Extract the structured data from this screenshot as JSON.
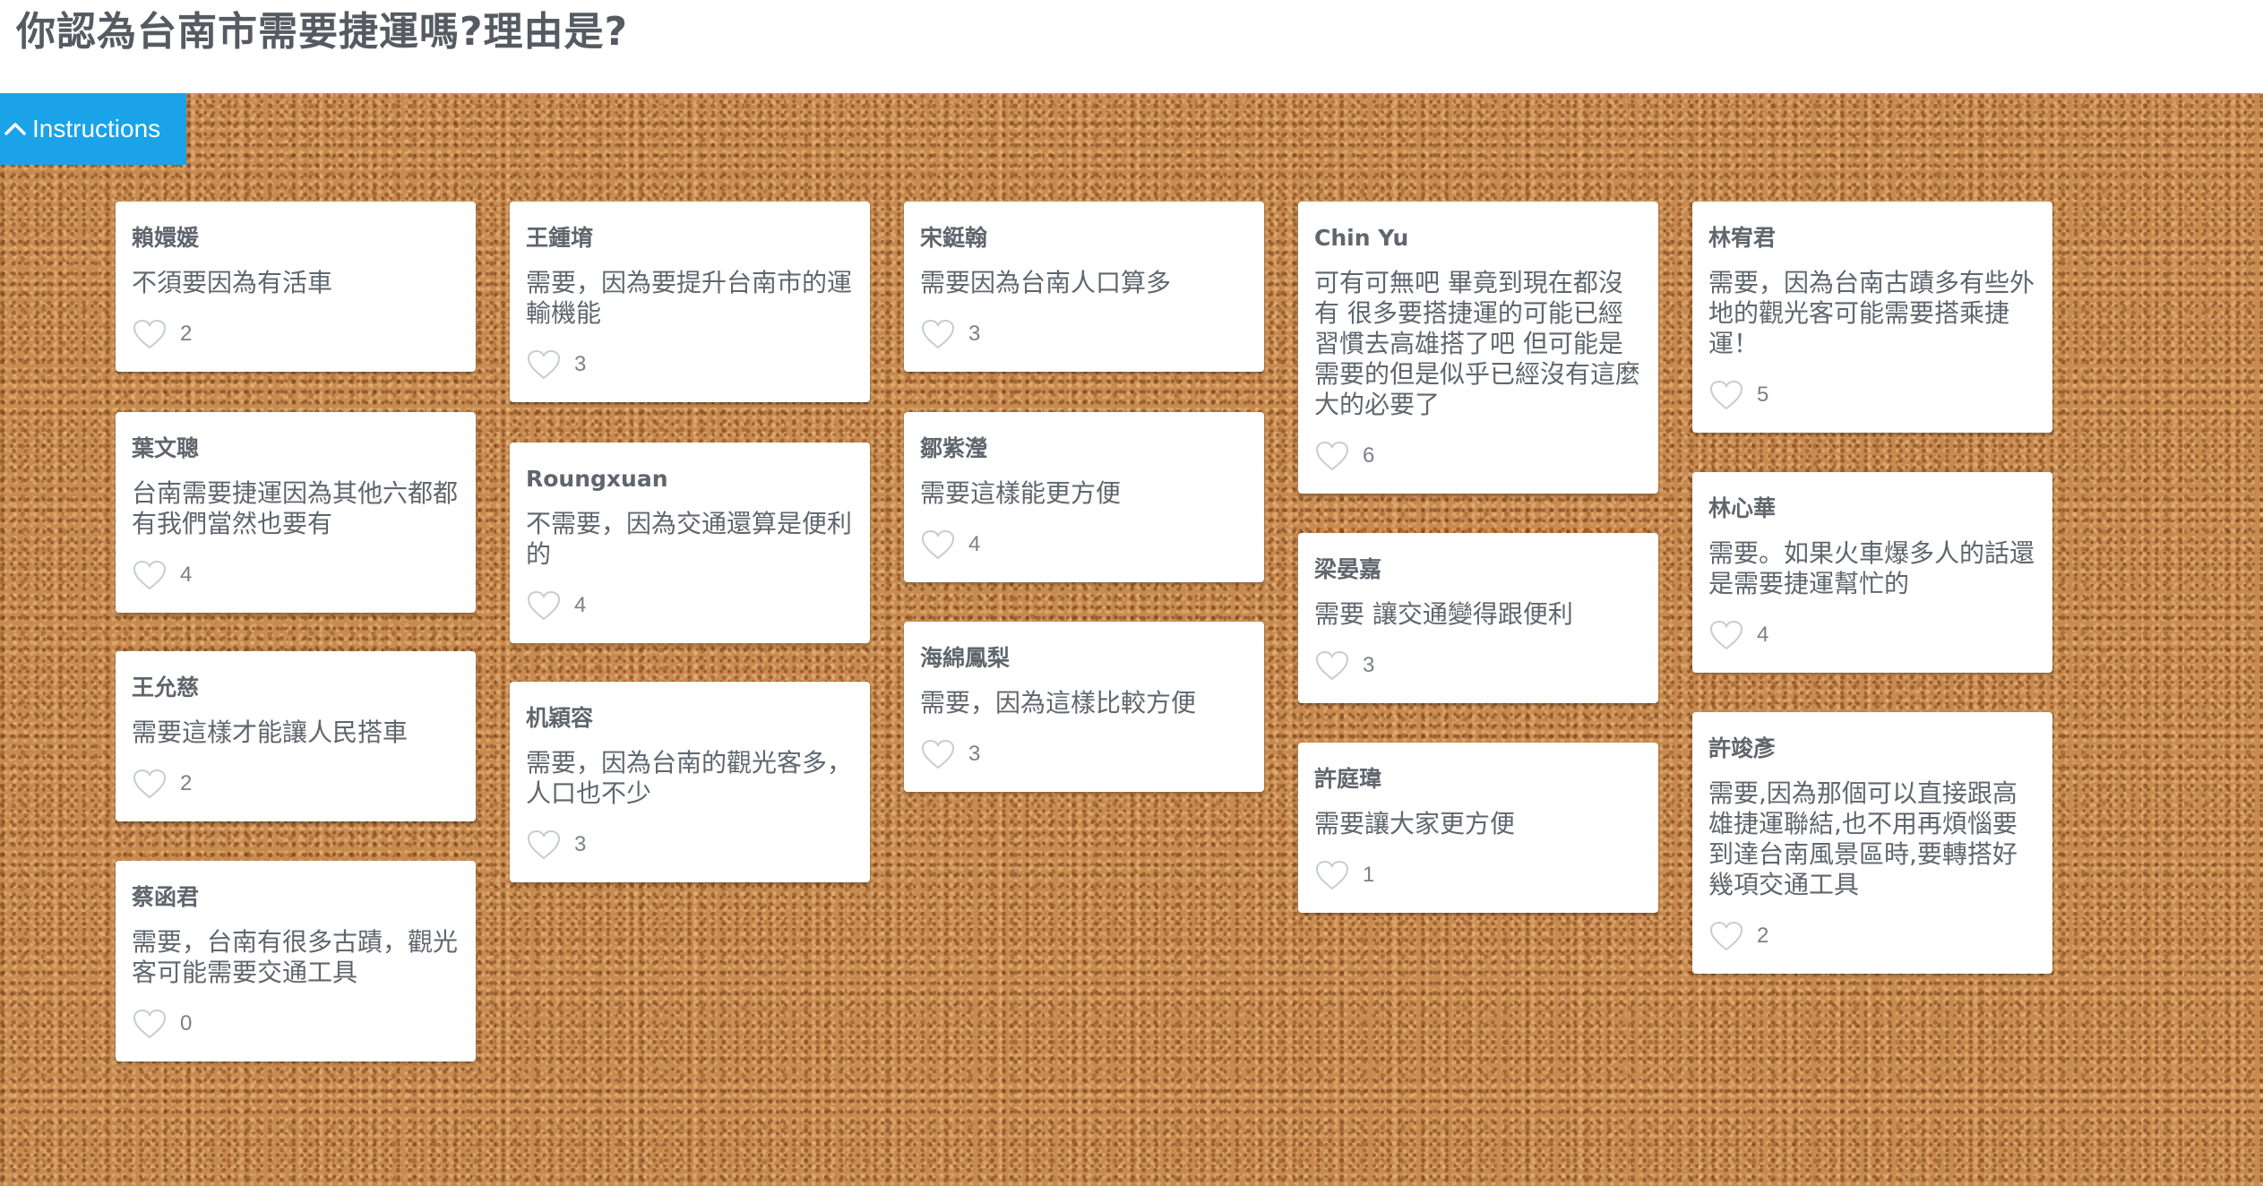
{
  "title": "你認為台南市需要捷運嗎?理由是?",
  "instructions_label": "Instructions",
  "icons": {
    "instructions_toggle": "chevron-up-icon",
    "like": "heart-outline-icon"
  },
  "colors": {
    "accent": "#1aa3e8",
    "board": "#c98a4e",
    "text": "#5f666d"
  },
  "cards": [
    {
      "author": "賴嬛媛",
      "text": "不須要因為有活車",
      "likes": "2"
    },
    {
      "author": "葉文聰",
      "text": "台南需要捷運因為其他六都都有我們當然也要有",
      "likes": "4"
    },
    {
      "author": "王允慈",
      "text": "需要這樣才能讓人民搭車",
      "likes": "2"
    },
    {
      "author": "蔡函君",
      "text": "需要，台南有很多古蹟，觀光客可能需要交通工具",
      "likes": "0"
    },
    {
      "author": "王鍾堉",
      "text": "需要，因為要提升台南市的運輸機能",
      "likes": "3"
    },
    {
      "author": "Roungxuan",
      "text": "不需要，因為交通還算是便利的",
      "likes": "4"
    },
    {
      "author": "机穎容",
      "text": "需要，因為台南的觀光客多，人口也不少",
      "likes": "3"
    },
    {
      "author": "宋鋌翰",
      "text": "需要因為台南人口算多",
      "likes": "3"
    },
    {
      "author": "鄒紫瀅",
      "text": "需要這樣能更方便",
      "likes": "4"
    },
    {
      "author": "海綿鳳梨",
      "text": "需要，因為這樣比較方便",
      "likes": "3"
    },
    {
      "author": "Chin Yu",
      "text": "可有可無吧 畢竟到現在都沒有 很多要搭捷運的可能已經習慣去高雄搭了吧 但可能是需要的但是似乎已經沒有這麼大的必要了",
      "likes": "6"
    },
    {
      "author": "梁晏嘉",
      "text": "需要 讓交通變得跟便利",
      "likes": "3"
    },
    {
      "author": "許庭瑋",
      "text": "需要讓大家更方便",
      "likes": "1"
    },
    {
      "author": "林宥君",
      "text": "需要，因為台南古蹟多有些外地的觀光客可能需要搭乘捷運！",
      "likes": "5"
    },
    {
      "author": "林心華",
      "text": "需要。如果火車爆多人的話還是需要捷運幫忙的",
      "likes": "4"
    },
    {
      "author": "許竣彥",
      "text": "需要,因為那個可以直接跟高雄捷運聯結,也不用再煩惱要到達台南風景區時,要轉搭好幾項交通工具",
      "likes": "2"
    }
  ]
}
